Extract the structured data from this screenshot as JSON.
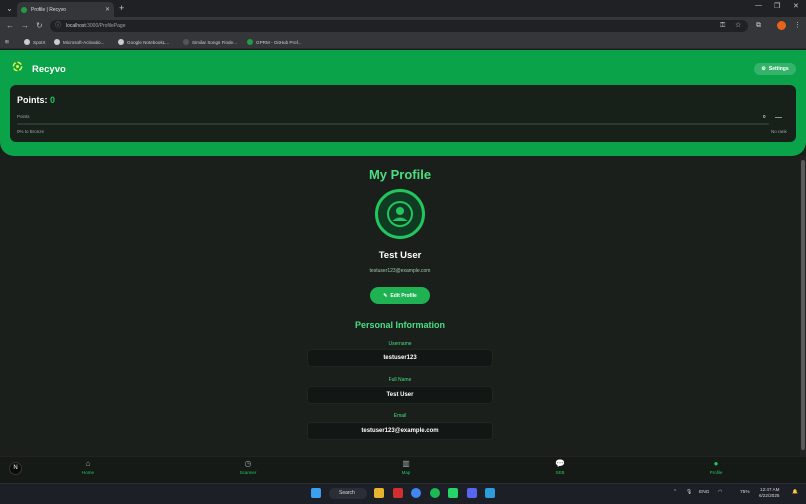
{
  "browser": {
    "tab_title": "Profile | Recyvo",
    "url_host": "localhost",
    "url_path": ":3000/ProfilePage",
    "bookmarks": [
      "SpotX",
      "Microsoft-Activatio...",
      "Google NotebookL...",
      "Similar Songs Finde...",
      "GPRM - GitHub Prof..."
    ]
  },
  "app": {
    "brand": "Recyvo",
    "settings_label": "Settings",
    "accent": "#22c55e",
    "header_bg": "#0aa34a"
  },
  "points": {
    "title": "Points:",
    "value": "0",
    "label": "Points",
    "right_value": "0",
    "rank_dash": "—",
    "progress_text": "0% to Bronze",
    "rank_text": "No rank",
    "progress_fraction": 0
  },
  "profile": {
    "title": "My Profile",
    "name": "Test User",
    "email": "testuser123@example.com",
    "edit_label": "Edit Profile"
  },
  "personal": {
    "title": "Personal Information",
    "fields": [
      {
        "label": "Username",
        "value": "testuser123"
      },
      {
        "label": "Full Name",
        "value": "Test User"
      },
      {
        "label": "Email",
        "value": "testuser123@example.com"
      }
    ]
  },
  "bottom_nav": {
    "items": [
      {
        "label": "Home",
        "icon": "home-icon"
      },
      {
        "label": "Scanner",
        "icon": "clock-icon"
      },
      {
        "label": "Map",
        "icon": "map-icon"
      },
      {
        "label": "SEB",
        "icon": "chat-icon"
      },
      {
        "label": "Profile",
        "icon": "user-icon"
      }
    ],
    "n_badge": "N"
  },
  "taskbar": {
    "search_label": "Search",
    "lang": "ENG",
    "battery": "75%",
    "time": "12:47 AM",
    "date": "6/22/2025"
  }
}
